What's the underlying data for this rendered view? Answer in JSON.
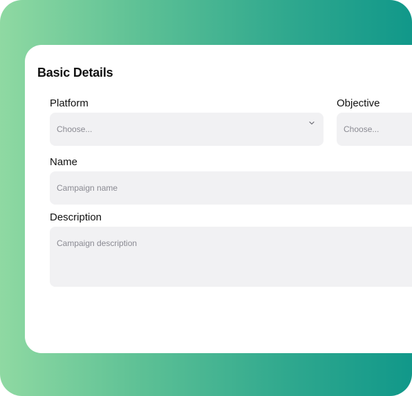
{
  "form": {
    "section_title": "Basic Details",
    "platform": {
      "label": "Platform",
      "placeholder": "Choose..."
    },
    "objective": {
      "label": "Objective",
      "placeholder": "Choose..."
    },
    "name": {
      "label": "Name",
      "placeholder": "Campaign name"
    },
    "description": {
      "label": "Description",
      "placeholder": "Campaign description"
    }
  },
  "icons": {
    "platform_dropdown": "chevron-down-icon"
  },
  "colors": {
    "gradient_start": "#8fd9a2",
    "gradient_end": "#11988a",
    "field_background": "#f1f1f3",
    "placeholder_text": "#8a8a92",
    "label_text": "#111111"
  }
}
